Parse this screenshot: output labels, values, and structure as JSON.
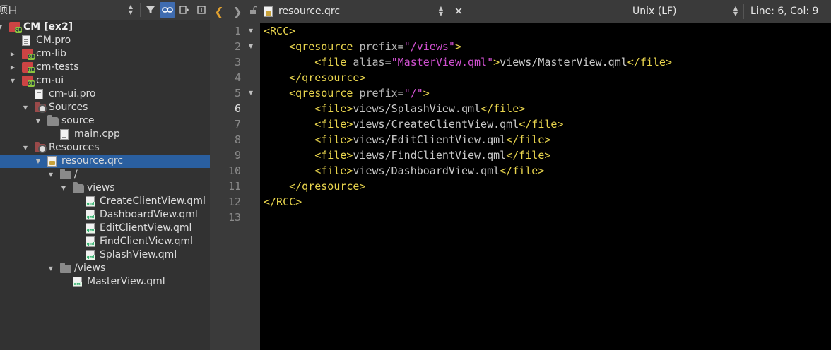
{
  "left_panel": {
    "title": "项目",
    "tree": [
      {
        "label": "CM [ex2]",
        "icon": "project-icon",
        "depth": 0,
        "arrow": "down",
        "bold": true
      },
      {
        "label": "CM.pro",
        "icon": "pro-file-icon",
        "depth": 1,
        "arrow": ""
      },
      {
        "label": "cm-lib",
        "icon": "project-icon",
        "depth": 1,
        "arrow": "right"
      },
      {
        "label": "cm-tests",
        "icon": "project-icon",
        "depth": 1,
        "arrow": "right"
      },
      {
        "label": "cm-ui",
        "icon": "project-icon",
        "depth": 1,
        "arrow": "down"
      },
      {
        "label": "cm-ui.pro",
        "icon": "pro-file-icon",
        "depth": 2,
        "arrow": ""
      },
      {
        "label": "Sources",
        "icon": "sources-folder-icon",
        "depth": 2,
        "arrow": "down"
      },
      {
        "label": "source",
        "icon": "folder-icon",
        "depth": 3,
        "arrow": "down"
      },
      {
        "label": "main.cpp",
        "icon": "cpp-file-icon",
        "depth": 4,
        "arrow": ""
      },
      {
        "label": "Resources",
        "icon": "resources-folder-icon",
        "depth": 2,
        "arrow": "down"
      },
      {
        "label": "resource.qrc",
        "icon": "qrc-file-icon",
        "depth": 3,
        "arrow": "down",
        "selected": true
      },
      {
        "label": "/",
        "icon": "folder-icon",
        "depth": 4,
        "arrow": "down"
      },
      {
        "label": "views",
        "icon": "folder-icon",
        "depth": 5,
        "arrow": "down"
      },
      {
        "label": "CreateClientView.qml",
        "icon": "qml-file-icon",
        "depth": 6,
        "arrow": ""
      },
      {
        "label": "DashboardView.qml",
        "icon": "qml-file-icon",
        "depth": 6,
        "arrow": ""
      },
      {
        "label": "EditClientView.qml",
        "icon": "qml-file-icon",
        "depth": 6,
        "arrow": ""
      },
      {
        "label": "FindClientView.qml",
        "icon": "qml-file-icon",
        "depth": 6,
        "arrow": ""
      },
      {
        "label": "SplashView.qml",
        "icon": "qml-file-icon",
        "depth": 6,
        "arrow": ""
      },
      {
        "label": "/views",
        "icon": "folder-icon",
        "depth": 4,
        "arrow": "down"
      },
      {
        "label": "MasterView.qml",
        "icon": "qml-file-icon",
        "depth": 5,
        "arrow": ""
      }
    ]
  },
  "editor_toolbar": {
    "file_name": "resource.qrc",
    "line_ending": "Unix (LF)",
    "position": "Line: 6, Col: 9"
  },
  "editor": {
    "current_line": 6,
    "lines": [
      {
        "num": "1",
        "fold": true,
        "tokens": [
          {
            "t": "tag",
            "s": "<RCC>"
          }
        ]
      },
      {
        "num": "2",
        "fold": true,
        "tokens": [
          {
            "t": "txt",
            "s": "    "
          },
          {
            "t": "tag",
            "s": "<qresource"
          },
          {
            "t": "attr",
            "s": " prefix="
          },
          {
            "t": "val",
            "s": "\"/views\""
          },
          {
            "t": "tag",
            "s": ">"
          }
        ]
      },
      {
        "num": "3",
        "fold": false,
        "tokens": [
          {
            "t": "txt",
            "s": "        "
          },
          {
            "t": "tag",
            "s": "<file"
          },
          {
            "t": "attr",
            "s": " alias="
          },
          {
            "t": "val",
            "s": "\"MasterView.qml\""
          },
          {
            "t": "tag",
            "s": ">"
          },
          {
            "t": "txt",
            "s": "views/MasterView.qml"
          },
          {
            "t": "tag",
            "s": "</file>"
          }
        ]
      },
      {
        "num": "4",
        "fold": false,
        "tokens": [
          {
            "t": "txt",
            "s": "    "
          },
          {
            "t": "tag",
            "s": "</qresource>"
          }
        ]
      },
      {
        "num": "5",
        "fold": true,
        "tokens": [
          {
            "t": "txt",
            "s": "    "
          },
          {
            "t": "tag",
            "s": "<qresource"
          },
          {
            "t": "attr",
            "s": " prefix="
          },
          {
            "t": "val",
            "s": "\"/\""
          },
          {
            "t": "tag",
            "s": ">"
          }
        ]
      },
      {
        "num": "6",
        "fold": false,
        "tokens": [
          {
            "t": "txt",
            "s": "        "
          },
          {
            "t": "tag",
            "s": "<file>"
          },
          {
            "t": "txt",
            "s": "views/SplashView.qml"
          },
          {
            "t": "tag",
            "s": "</file>"
          }
        ]
      },
      {
        "num": "7",
        "fold": false,
        "tokens": [
          {
            "t": "txt",
            "s": "        "
          },
          {
            "t": "tag",
            "s": "<file>"
          },
          {
            "t": "txt",
            "s": "views/CreateClientView.qml"
          },
          {
            "t": "tag",
            "s": "</file>"
          }
        ]
      },
      {
        "num": "8",
        "fold": false,
        "tokens": [
          {
            "t": "txt",
            "s": "        "
          },
          {
            "t": "tag",
            "s": "<file>"
          },
          {
            "t": "txt",
            "s": "views/EditClientView.qml"
          },
          {
            "t": "tag",
            "s": "</file>"
          }
        ]
      },
      {
        "num": "9",
        "fold": false,
        "tokens": [
          {
            "t": "txt",
            "s": "        "
          },
          {
            "t": "tag",
            "s": "<file>"
          },
          {
            "t": "txt",
            "s": "views/FindClientView.qml"
          },
          {
            "t": "tag",
            "s": "</file>"
          }
        ]
      },
      {
        "num": "10",
        "fold": false,
        "tokens": [
          {
            "t": "txt",
            "s": "        "
          },
          {
            "t": "tag",
            "s": "<file>"
          },
          {
            "t": "txt",
            "s": "views/DashboardView.qml"
          },
          {
            "t": "tag",
            "s": "</file>"
          }
        ]
      },
      {
        "num": "11",
        "fold": false,
        "tokens": [
          {
            "t": "txt",
            "s": "    "
          },
          {
            "t": "tag",
            "s": "</qresource>"
          }
        ]
      },
      {
        "num": "12",
        "fold": false,
        "tokens": [
          {
            "t": "tag",
            "s": "</RCC>"
          }
        ]
      },
      {
        "num": "13",
        "fold": false,
        "tokens": []
      }
    ]
  },
  "colors": {
    "tag": "#e8d44d",
    "attribute_value": "#d050d0",
    "selection": "#2a5fa0",
    "panel_bg": "#323232",
    "editor_bg": "#000000"
  }
}
